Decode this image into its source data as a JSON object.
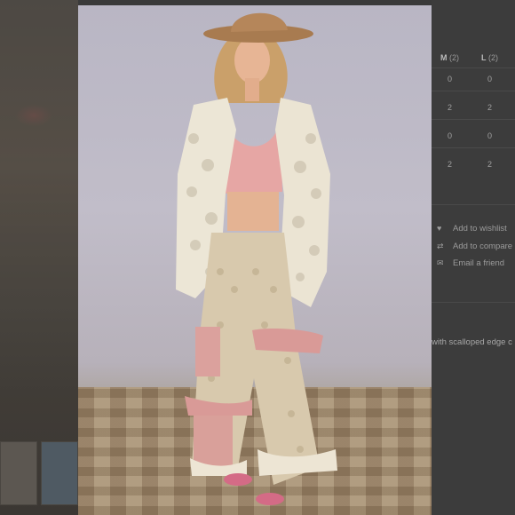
{
  "size_table": {
    "headers": [
      {
        "label": "M",
        "count": "(2)"
      },
      {
        "label": "L",
        "count": "(2)"
      }
    ],
    "rows": [
      [
        "0",
        "0"
      ],
      [
        "2",
        "2"
      ],
      [
        "0",
        "0"
      ],
      [
        "2",
        "2"
      ]
    ]
  },
  "actions": [
    {
      "icon": "heart-icon",
      "glyph": "♥",
      "label": "Add to wishlist"
    },
    {
      "icon": "compare-icon",
      "glyph": "⇄",
      "label": "Add to compare"
    },
    {
      "icon": "email-icon",
      "glyph": "✉",
      "label": "Email a friend"
    }
  ],
  "description_snippet": "with scalloped edge c",
  "colors": {
    "overlay": "#3a3a3a",
    "backdrop": "#bdb9c6",
    "hat": "#b5865a",
    "cardigan": "#ece6d6",
    "lace_top": "#e6a6a4",
    "pants_base": "#d8c9ad",
    "ruffle_pink": "#d99a97"
  }
}
